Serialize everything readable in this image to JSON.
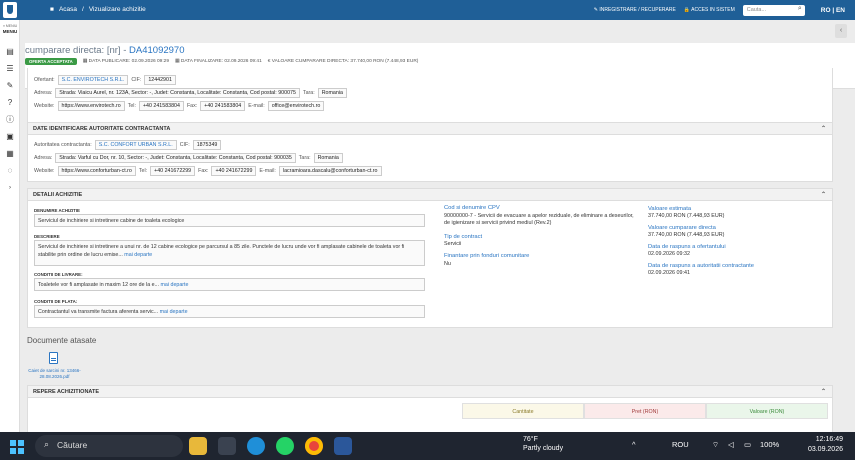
{
  "topbar": {
    "breadcrumb": [
      "Acasa",
      "/",
      "Vizualizare achizitie"
    ],
    "register_label": "INREGISTRARE / RECUPERARE",
    "login_label": "ACCES IN SISTEM",
    "search_placeholder": "Cauta...",
    "lang_ro": "RO",
    "lang_sep": "|",
    "lang_en": "EN"
  },
  "sidebar": {
    "menu_top": "≡ MENIU",
    "menu_label": "MENIU"
  },
  "header": {
    "title_prefix": "cumparare directa: [nr] - ",
    "title_code": "DA41092970",
    "status_badge": "OFERTA ACCEPTATA",
    "publish_date": "DATA PUBLICARE: 02.09.2026 09:29",
    "finalize_date": "DATA FINALIZARE: 02.09.2026 09:41",
    "estimated_value": "VALOARE CUMPARARE DIRECTA: 37.740,00 RON (7.448,93 EUR)"
  },
  "supplier": {
    "ofertant_label": "Ofertant:",
    "ofertant_name": "S.C. ENVIROTECH S.R.L.",
    "cif_label": "CIF:",
    "cif": "12442901",
    "address_label": "Adresa:",
    "address": "Strada: Viaicu Aurel, nr. 123A, Sector: -, Judet: Constanta, Localitate: Constanta, Cod postal: 900075",
    "country_label": "Tara:",
    "country": "Romania",
    "website_label": "Website:",
    "website": "https://www.envirotech.ro",
    "tel_label": "Tel:",
    "tel": "+40 241583804",
    "fax_label": "Fax:",
    "fax": "+40 241583804",
    "email_label": "E-mail:",
    "email": "office@envirotech.ro"
  },
  "authority": {
    "section_title": "DATE IDENTIFICARE AUTORITATE CONTRACTANTA",
    "name_label": "Autoritatea contractanta:",
    "name": "S.C. CONFORT URBAN S.R.L.",
    "cif_label": "CIF:",
    "cif": "1875349",
    "address_label": "Adresa:",
    "address": "Strada: Varful cu Dor, nr. 10, Sector: -, Judet: Constanta, Localitate: Constanta, Cod postal: 900035",
    "country_label": "Tara:",
    "country": "Romania",
    "website_label": "Website:",
    "website": "https://www.conforturban-ct.ro",
    "tel_label": "Tel:",
    "tel": "+40 241672299",
    "fax_label": "Fax:",
    "fax": "+40 241672299",
    "email_label": "E-mail:",
    "email": "lacramioara.dascalu@conforturban-ct.ro"
  },
  "details": {
    "section_title": "DETALII ACHIZITIE",
    "name_label": "DENUMIRE ACHIZITIE",
    "name": "Serviciul de inchiriere si intretinere cabine de toaleta ecologice",
    "desc_label": "DESCRIERE",
    "desc": "Serviciul de inchiriere si intretinere a unui nr. de 12 cabine ecologice pe parcursul a 85 zile. Punctele de lucru unde vor fi amplasate cabinele de toaleta vor fi stabilite prin ordine de lucru emise...",
    "more": "mai departe",
    "delivery_label": "CONDITII DE LIVRARE:",
    "delivery": "Toaletele vor fi amplasate in maxim 12 ore de la e...",
    "payment_label": "CONDITII DE PLATA:",
    "payment": "Contractantul va transmite factura aferenta servic...",
    "cpv_label": "Cod si denumire CPV",
    "cpv": "90000000-7 - Servicii de evacuare a apelor reziduale, de eliminare a deseurilor, de igienizare si servicii privind mediul (Rev.2)",
    "type_label": "Tip de contract",
    "type": "Servicii",
    "eu_label": "Finantare prin fonduri comunitare",
    "eu": "Nu",
    "est_label": "Valoare estimata",
    "est": "37.740,00  RON (7.448,93  EUR)",
    "val_label": "Valoare cumparare directa",
    "val": "37.740,00  RON (7.448,93  EUR)",
    "resp_offer_label": "Data de raspuns a ofertantului",
    "resp_offer": "02.09.2026 09:32",
    "resp_auth_label": "Data de raspuns a autoritatii contractante",
    "resp_auth": "02.09.2026 09:41"
  },
  "documents": {
    "title": "Documente atasate",
    "file_name": "Caiet de sarcini nr. 13466-28.08.2026.pdf"
  },
  "repere": {
    "section_title": "REPERE ACHIZITIONATE",
    "col_qty": "Cantitate",
    "col_price": "Pret (RON)",
    "col_value": "Valoare (RON)"
  },
  "taskbar": {
    "search": "Căutare",
    "temp": "76°F",
    "weather": "Partly cloudy",
    "lang": "ROU",
    "battery": "100%",
    "time": "12:16:49",
    "date": "03.09.2026"
  },
  "colors": {
    "brand": "#1f5f97",
    "link": "#2a75c2",
    "status_ok": "#3a9a45"
  }
}
